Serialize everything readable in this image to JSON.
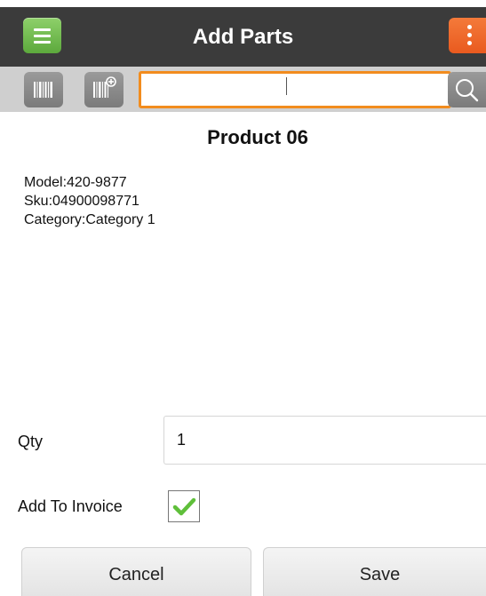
{
  "header": {
    "title": "Add Parts",
    "menu_icon": "hamburger-menu-icon",
    "overflow_icon": "more-vert-icon",
    "accent_green": "#6bbf47",
    "accent_orange": "#ed6a2a"
  },
  "toolbar": {
    "scan_icon": "barcode-icon",
    "add_scan_icon": "barcode-add-icon",
    "search_icon": "search-icon",
    "scan_input_value": "",
    "scan_input_placeholder": ""
  },
  "product": {
    "title": "Product 06",
    "model": "Model:420-9877",
    "sku": "Sku:04900098771",
    "category": "Category:Category 1"
  },
  "form": {
    "qty_label": "Qty",
    "qty_value": "1",
    "invoice_label": "Add To Invoice",
    "invoice_checked": "true"
  },
  "actions": {
    "cancel_label": "Cancel",
    "save_label": "Save"
  }
}
